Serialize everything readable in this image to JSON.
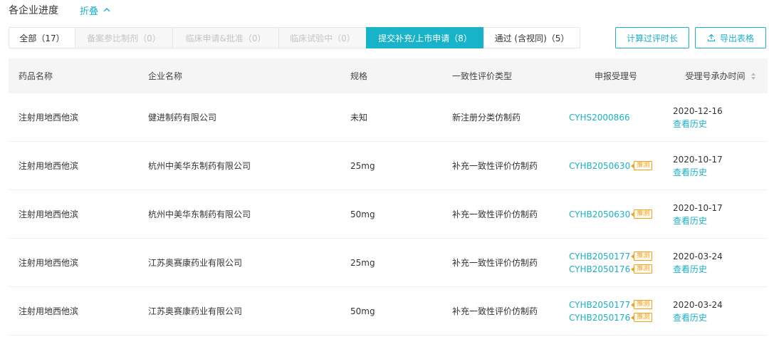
{
  "header": {
    "title": "各企业进度",
    "fold_label": "折叠"
  },
  "tabs": [
    {
      "label": "全部（17）",
      "state": "normal"
    },
    {
      "label": "备案参比制剂（0）",
      "state": "disabled"
    },
    {
      "label": "临床申请&批准（0）",
      "state": "disabled"
    },
    {
      "label": "临床试验中（0）",
      "state": "disabled"
    },
    {
      "label": "提交补充/上市申请（8）",
      "state": "active"
    },
    {
      "label": "通过 (含视同)（5）",
      "state": "normal"
    }
  ],
  "actions": {
    "calc_label": "计算过评时长",
    "export_label": "导出表格"
  },
  "table": {
    "headers": [
      "药品名称",
      "企业名称",
      "规格",
      "一致性评价类型",
      "申报受理号",
      "受理号承办时间"
    ],
    "history_label": "查看历史",
    "badge_label": "推测",
    "rows": [
      {
        "drug": "注射用地西他滨",
        "company": "健进制药有限公司",
        "spec": "未知",
        "type": "新注册分类仿制药",
        "codes": [
          {
            "code": "CYHS2000866",
            "badge": false
          }
        ],
        "date": "2020-12-16"
      },
      {
        "drug": "注射用地西他滨",
        "company": "杭州中美华东制药有限公司",
        "spec": "25mg",
        "type": "补充一致性评价仿制药",
        "codes": [
          {
            "code": "CYHB2050630",
            "badge": true
          }
        ],
        "date": "2020-10-17"
      },
      {
        "drug": "注射用地西他滨",
        "company": "杭州中美华东制药有限公司",
        "spec": "50mg",
        "type": "补充一致性评价仿制药",
        "codes": [
          {
            "code": "CYHB2050630",
            "badge": true
          }
        ],
        "date": "2020-10-17"
      },
      {
        "drug": "注射用地西他滨",
        "company": "江苏奥赛康药业有限公司",
        "spec": "25mg",
        "type": "补充一致性评价仿制药",
        "codes": [
          {
            "code": "CYHB2050177",
            "badge": true
          },
          {
            "code": "CYHB2050176",
            "badge": true
          }
        ],
        "date": "2020-03-24"
      },
      {
        "drug": "注射用地西他滨",
        "company": "江苏奥赛康药业有限公司",
        "spec": "50mg",
        "type": "补充一致性评价仿制药",
        "codes": [
          {
            "code": "CYHB2050177",
            "badge": true
          },
          {
            "code": "CYHB2050176",
            "badge": true
          }
        ],
        "date": "2020-03-24"
      }
    ]
  },
  "colors": {
    "accent": "#18b2c9",
    "badge": "#f4a11e"
  },
  "icons": {
    "fold": "chevron-up-icon",
    "export": "upload-icon",
    "sort": "sort-icon"
  }
}
